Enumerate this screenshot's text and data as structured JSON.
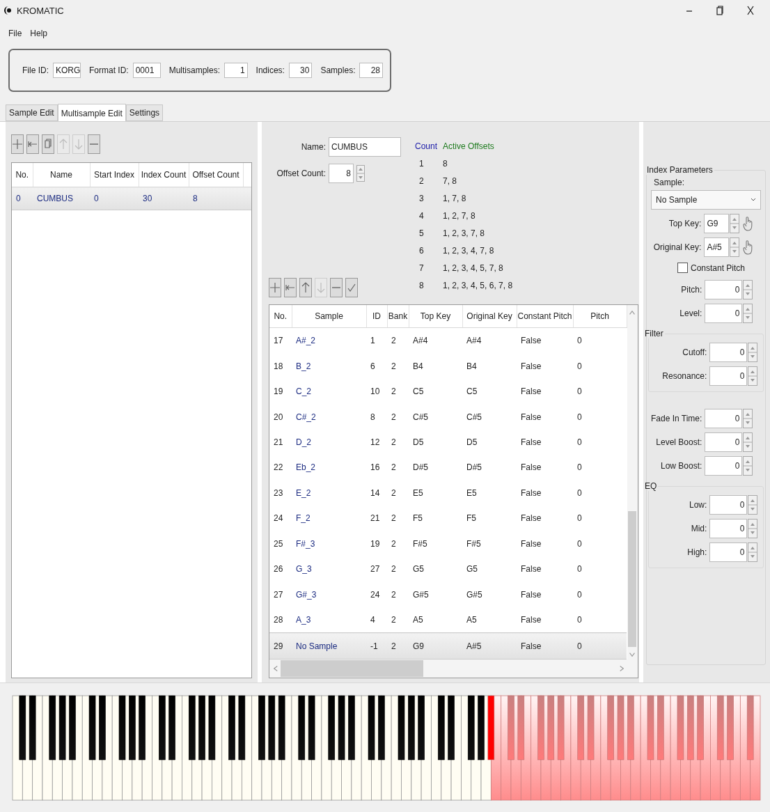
{
  "window": {
    "title": "KROMATIC"
  },
  "menu": [
    "File",
    "Help"
  ],
  "file_info": [
    {
      "label": "File ID:",
      "value": "KORG",
      "kind": "code"
    },
    {
      "label": "Format ID:",
      "value": "0001",
      "kind": "code"
    },
    {
      "label": "Multisamples:",
      "value": "1",
      "kind": "number"
    },
    {
      "label": "Indices:",
      "value": "30",
      "kind": "number"
    },
    {
      "label": "Samples:",
      "value": "28",
      "kind": "number"
    }
  ],
  "tabs": [
    {
      "label": "Sample Edit",
      "selected": false
    },
    {
      "label": "Multisample Edit",
      "selected": true
    },
    {
      "label": "Settings",
      "selected": false
    }
  ],
  "multisample_list": {
    "toolbar": [
      {
        "kind": "add",
        "disabled": false
      },
      {
        "kind": "insert",
        "disabled": false
      },
      {
        "kind": "copy",
        "disabled": false
      },
      {
        "kind": "up",
        "disabled": true
      },
      {
        "kind": "down",
        "disabled": true
      },
      {
        "kind": "remove",
        "disabled": false
      }
    ],
    "columns": [
      "No.",
      "Name",
      "Start Index",
      "Index Count",
      "Offset Count"
    ],
    "rows": [
      {
        "cells": [
          "0",
          "CUMBUS",
          "0",
          "30",
          "8"
        ],
        "selected": true
      }
    ]
  },
  "multisample": {
    "name_label": "Name:",
    "name": "CUMBUS",
    "offset_count_label": "Offset Count:",
    "offset_count": "8",
    "offsets_header": {
      "count": "Count",
      "active": "Active Offsets"
    },
    "offsets": [
      {
        "count": "1",
        "active": "8"
      },
      {
        "count": "2",
        "active": "7, 8"
      },
      {
        "count": "3",
        "active": "1, 7, 8"
      },
      {
        "count": "4",
        "active": "1, 2, 7, 8"
      },
      {
        "count": "5",
        "active": "1, 2, 3, 7, 8"
      },
      {
        "count": "6",
        "active": "1, 2, 3, 4, 7, 8"
      },
      {
        "count": "7",
        "active": "1, 2, 3, 4, 5, 7, 8"
      },
      {
        "count": "8",
        "active": "1, 2, 3, 4, 5, 6, 7, 8"
      }
    ]
  },
  "index_toolbar": [
    {
      "kind": "add",
      "disabled": false
    },
    {
      "kind": "insert",
      "disabled": false
    },
    {
      "kind": "up",
      "disabled": false
    },
    {
      "kind": "down",
      "disabled": true
    },
    {
      "kind": "remove",
      "disabled": false
    },
    {
      "kind": "apply",
      "disabled": false
    }
  ],
  "index_table": {
    "columns": [
      "No.",
      "Sample",
      "ID",
      "Bank",
      "Top Key",
      "Original Key",
      "Constant Pitch",
      "Pitch"
    ],
    "rows": [
      {
        "cells": [
          "17",
          "A#_2",
          "1",
          "2",
          "A#4",
          "A#4",
          "False",
          "0"
        ],
        "selected": false
      },
      {
        "cells": [
          "18",
          "B_2",
          "6",
          "2",
          "B4",
          "B4",
          "False",
          "0"
        ],
        "selected": false
      },
      {
        "cells": [
          "19",
          "C_2",
          "10",
          "2",
          "C5",
          "C5",
          "False",
          "0"
        ],
        "selected": false
      },
      {
        "cells": [
          "20",
          "C#_2",
          "8",
          "2",
          "C#5",
          "C#5",
          "False",
          "0"
        ],
        "selected": false
      },
      {
        "cells": [
          "21",
          "D_2",
          "12",
          "2",
          "D5",
          "D5",
          "False",
          "0"
        ],
        "selected": false
      },
      {
        "cells": [
          "22",
          "Eb_2",
          "16",
          "2",
          "D#5",
          "D#5",
          "False",
          "0"
        ],
        "selected": false
      },
      {
        "cells": [
          "23",
          "E_2",
          "14",
          "2",
          "E5",
          "E5",
          "False",
          "0"
        ],
        "selected": false
      },
      {
        "cells": [
          "24",
          "F_2",
          "21",
          "2",
          "F5",
          "F5",
          "False",
          "0"
        ],
        "selected": false
      },
      {
        "cells": [
          "25",
          "F#_3",
          "19",
          "2",
          "F#5",
          "F#5",
          "False",
          "0"
        ],
        "selected": false
      },
      {
        "cells": [
          "26",
          "G_3",
          "27",
          "2",
          "G5",
          "G5",
          "False",
          "0"
        ],
        "selected": false
      },
      {
        "cells": [
          "27",
          "G#_3",
          "24",
          "2",
          "G#5",
          "G#5",
          "False",
          "0"
        ],
        "selected": false
      },
      {
        "cells": [
          "28",
          "A_3",
          "4",
          "2",
          "A5",
          "A5",
          "False",
          "0"
        ],
        "selected": false
      },
      {
        "cells": [
          "29",
          "No Sample",
          "-1",
          "2",
          "G9",
          "A#5",
          "False",
          "0"
        ],
        "selected": true
      }
    ]
  },
  "index_parameters": {
    "title": "Index Parameters",
    "sample_label": "Sample:",
    "sample": "No Sample",
    "top_key": {
      "label": "Top Key:",
      "value": "G9"
    },
    "original_key": {
      "label": "Original Key:",
      "value": "A#5"
    },
    "constant_pitch": {
      "label": "Constant Pitch",
      "checked": false
    },
    "fields": [
      {
        "label": "Pitch:",
        "value": "0"
      },
      {
        "label": "Level:",
        "value": "0"
      }
    ],
    "filter": {
      "title": "Filter",
      "fields": [
        {
          "label": "Cutoff:",
          "value": "0"
        },
        {
          "label": "Resonance:",
          "value": "0"
        }
      ]
    },
    "envelope_fields": [
      {
        "label": "Fade In Time:",
        "value": "0"
      },
      {
        "label": "Level Boost:",
        "value": "0"
      },
      {
        "label": "Low Boost:",
        "value": "0"
      }
    ],
    "eq": {
      "title": "EQ",
      "fields": [
        {
          "label": "Low:",
          "value": "0"
        },
        {
          "label": "Mid:",
          "value": "0"
        },
        {
          "label": "High:",
          "value": "0"
        }
      ]
    }
  }
}
